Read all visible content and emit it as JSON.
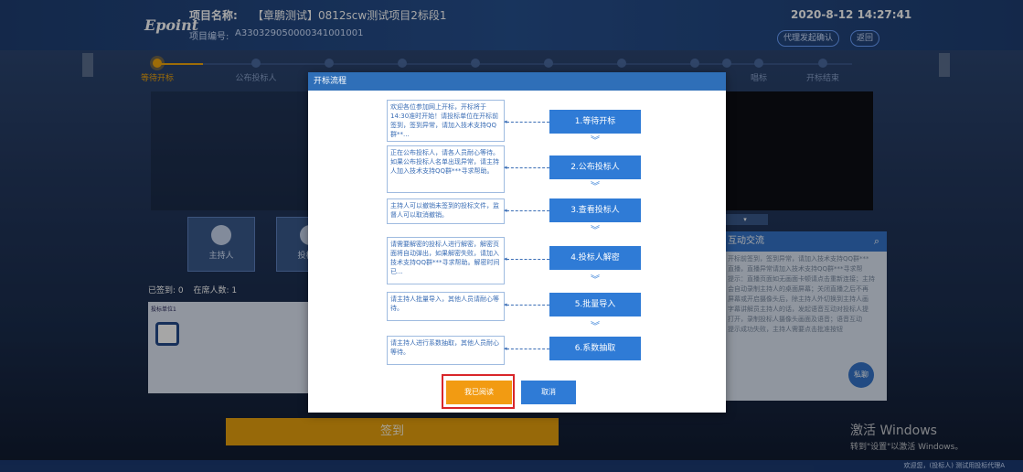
{
  "header": {
    "logo": "Epoint",
    "project_name_label": "项目名称:",
    "project_name": "【章鹏测试】0812scw测试项目2标段1",
    "project_code_label": "项目编号:",
    "project_code": "A330329050000341001001",
    "datetime": "2020-8-12  14:27:41",
    "btn_agent": "代理发起确认",
    "btn_back": "返回"
  },
  "stepper": {
    "steps": [
      "等待开标",
      "公布投标人",
      "",
      "",
      "",
      "",
      "",
      "",
      "",
      "唱标",
      "开标结束"
    ]
  },
  "background": {
    "role_host": "主持人",
    "role_bidder": "投标人",
    "signed_label": "已签到: 0",
    "online_label": "在席人数: 1",
    "seat_label": "投标单位1",
    "chat_title": "互动交流",
    "chat_lines": [
      "开标前签到，签到异常，请加入技术支持QQ群***",
      "直播，直播异常请加入技术支持QQ群***寻求帮",
      "提示：直播页面如无画面卡顿请点击重新连接；主持",
      "会自动录制主持人的桌面屏幕；关闭直播之后不再",
      "屏幕或开启摄像头后，除主持人外切换到主持人画",
      "字幕讲解员主持人的话，发起语音互动对投标人提",
      "打开，录制投标人摄像头画面及语音；语音互动",
      "提示成功失败，主持人需要点击批准按钮"
    ],
    "chat_fab": "私聊",
    "signin": "签到",
    "win_activate": "激活 Windows",
    "win_hint": "转到\"设置\"以激活 Windows。",
    "footer": "欢迎您，(投标人) 测试用投标代理A"
  },
  "modal": {
    "title": "开标流程",
    "stages": [
      {
        "label": "1.等待开标",
        "note": "欢迎各位参加网上开标，开标将于14:30准时开始！请投标单位在开标前签到，签到异常，请加入技术支持QQ群**..."
      },
      {
        "label": "2.公布投标人",
        "note": "正在公布投标人，请各人员耐心等待。如果公布投标人名单出现异常，请主持人加入技术支持QQ群***寻求帮助。"
      },
      {
        "label": "3.查看投标人",
        "note": "主持人可以撤销未签到的投标文件，监督人可以取消撤销。"
      },
      {
        "label": "4.投标人解密",
        "note": "请需要解密的投标人进行解密，解密页面将自动弹出，如果解密失败，请加入技术支持QQ群***寻求帮助。解密时间已..."
      },
      {
        "label": "5.批量导入",
        "note": "请主持人批量导入，其他人员请耐心等待。"
      },
      {
        "label": "6.系数抽取",
        "note": "请主持人进行系数抽取，其他人员耐心等待。"
      }
    ],
    "btn_read": "我已阅读",
    "btn_cancel": "取消"
  },
  "colors": {
    "accent_orange": "#f29b12",
    "primary_blue": "#2f7bd6",
    "highlight_red": "#d9262a"
  }
}
